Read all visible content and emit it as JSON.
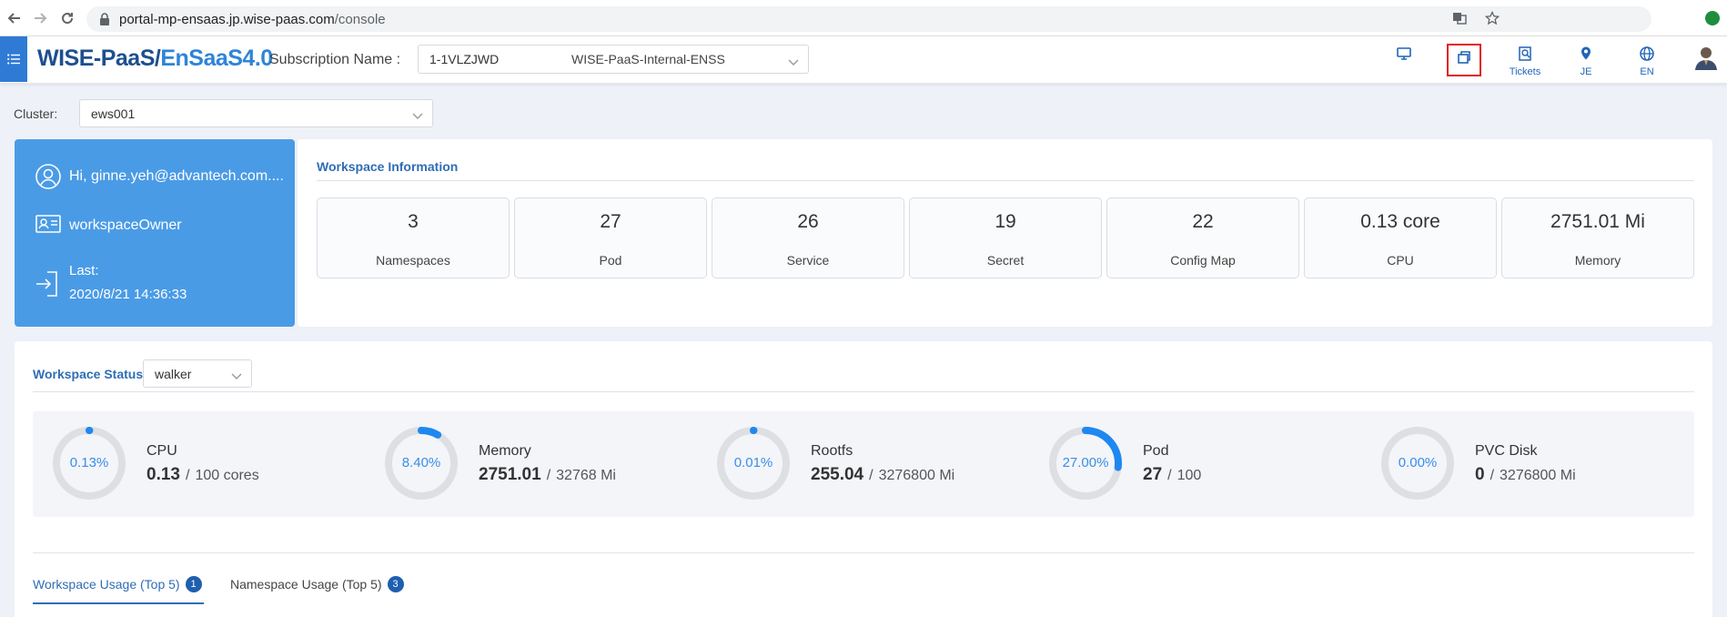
{
  "browser": {
    "url_host": "portal-mp-ensaas.jp.wise-paas.com",
    "url_path": "/console"
  },
  "header": {
    "brand_part1": "WISE-PaaS/",
    "brand_part2": "EnSaaS4.0",
    "subscription_label": "Subscription Name :",
    "subscription_id": "1-1VLZJWD",
    "subscription_name": "WISE-PaaS-Internal-ENSS",
    "icons": {
      "tickets_label": "Tickets",
      "user_label": "JE",
      "lang_label": "EN"
    }
  },
  "cluster": {
    "label": "Cluster:",
    "value": "ews001"
  },
  "user_card": {
    "greeting": "Hi, ginne.yeh@advantech.com....",
    "role": "workspaceOwner",
    "last_label": "Last:",
    "last_time": "2020/8/21 14:36:33"
  },
  "workspace_info": {
    "title": "Workspace Information",
    "stats": [
      {
        "value": "3",
        "label": "Namespaces"
      },
      {
        "value": "27",
        "label": "Pod"
      },
      {
        "value": "26",
        "label": "Service"
      },
      {
        "value": "19",
        "label": "Secret"
      },
      {
        "value": "22",
        "label": "Config Map"
      },
      {
        "value": "0.13 core",
        "label": "CPU"
      },
      {
        "value": "2751.01 Mi",
        "label": "Memory"
      }
    ]
  },
  "workspace_status": {
    "title": "Workspace Status",
    "selected": "walker",
    "metrics": [
      {
        "name": "CPU",
        "percent_text": "0.13%",
        "percent": 0.13,
        "used": "0.13",
        "total": "100 cores"
      },
      {
        "name": "Memory",
        "percent_text": "8.40%",
        "percent": 8.4,
        "used": "2751.01",
        "total": "32768 Mi"
      },
      {
        "name": "Rootfs",
        "percent_text": "0.01%",
        "percent": 0.01,
        "used": "255.04",
        "total": "3276800 Mi"
      },
      {
        "name": "Pod",
        "percent_text": "27.00%",
        "percent": 27.0,
        "used": "27",
        "total": "100"
      },
      {
        "name": "PVC Disk",
        "percent_text": "0.00%",
        "percent": 0.0,
        "used": "0",
        "total": "3276800 Mi"
      }
    ],
    "tabs": [
      {
        "label": "Workspace Usage (Top 5)",
        "badge": "1"
      },
      {
        "label": "Namespace Usage (Top 5)",
        "badge": "3"
      }
    ]
  },
  "colors": {
    "accent": "#2f6db5",
    "card_blue": "#4a9be6",
    "ring_progress": "#1e88f0",
    "ring_track": "#dedfe3",
    "highlight_box": "#e02020"
  }
}
